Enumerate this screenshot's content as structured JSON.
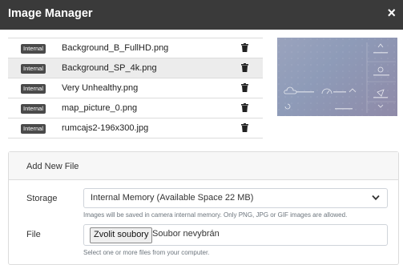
{
  "header": {
    "title": "Image Manager",
    "close_label": "×"
  },
  "files": [
    {
      "badge": "Internal",
      "name": "Background_B_FullHD.png"
    },
    {
      "badge": "Internal",
      "name": "Background_SP_4k.png"
    },
    {
      "badge": "Internal",
      "name": "Very Unhealthy.png"
    },
    {
      "badge": "Internal",
      "name": "map_picture_0.png"
    },
    {
      "badge": "Internal",
      "name": "rumcajs2-196x300.jpg"
    }
  ],
  "selected_index": 1,
  "add_file": {
    "title": "Add New File",
    "storage_label": "Storage",
    "storage_value": "Internal Memory (Available Space 22 MB)",
    "storage_help": "Images will be saved in camera internal memory. Only PNG, JPG or GIF images are allowed.",
    "file_label": "File",
    "file_button": "Zvolit soubory",
    "file_status": "Soubor nevybrán",
    "file_help": "Select one or more files from your computer."
  },
  "icons": {
    "close": "close-icon",
    "trash": "trash-icon",
    "chevron": "chevron-down-icon"
  }
}
